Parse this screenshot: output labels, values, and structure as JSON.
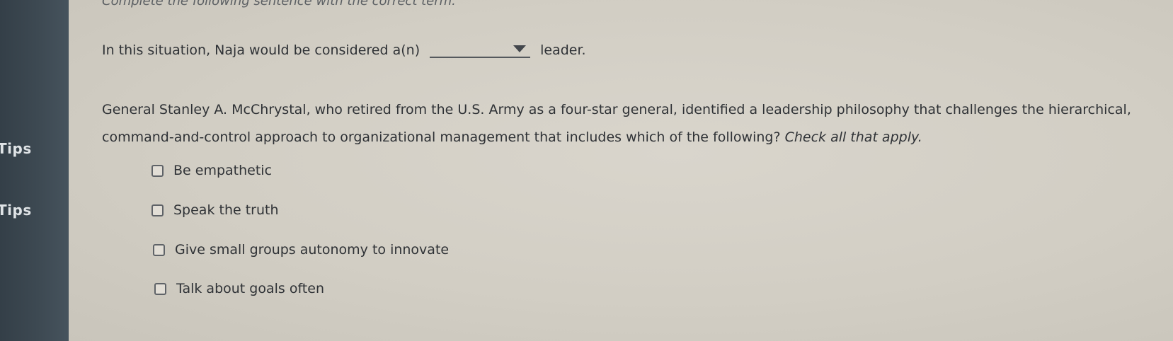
{
  "sidebar": {
    "labels": [
      "Tips",
      "Tips"
    ]
  },
  "instruction": "Complete the following sentence with the correct term.",
  "sentence": {
    "before": "In this situation, Naja would be considered a(n)",
    "dropdown_value": "",
    "after": "leader."
  },
  "question": {
    "text": "General Stanley A. McChrystal, who retired from the U.S. Army as a four-star general, identified a leadership philosophy that challenges the hierarchical, command-and-control approach to organizational management that includes which of the following?",
    "hint": "Check all that apply."
  },
  "options": [
    {
      "label": "Be empathetic",
      "checked": false
    },
    {
      "label": "Speak the truth",
      "checked": false
    },
    {
      "label": "Give small groups autonomy to innovate",
      "checked": false
    },
    {
      "label": "Talk about goals often",
      "checked": false
    }
  ],
  "icons": {
    "dropdown": "chevron-down-icon",
    "checkbox": "checkbox-icon"
  }
}
